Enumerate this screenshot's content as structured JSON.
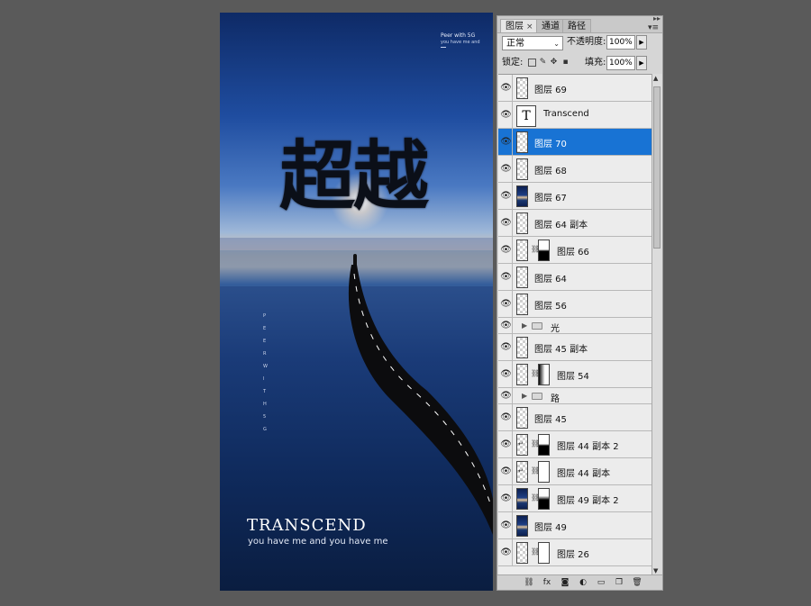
{
  "canvas": {
    "peer_line1": "Peer with 5G",
    "peer_line2": "you have me and",
    "hero_title": "超越",
    "vertical_text": "P\nE\nE\nR\nW\nI\nT\nH\n5\nG",
    "transcend": "TRANSCEND",
    "tagline": "you have me and you have me"
  },
  "panel": {
    "tabs": [
      {
        "label": "图层",
        "active": true
      },
      {
        "label": "通道",
        "active": false
      },
      {
        "label": "路径",
        "active": false
      }
    ],
    "blend_mode": "正常",
    "opacity_label": "不透明度:",
    "opacity_value": "100%",
    "lock_label": "锁定:",
    "fill_label": "填充:",
    "fill_value": "100%",
    "layers": [
      {
        "name": "图层 69",
        "kind": "pixel",
        "selected": false
      },
      {
        "name": "Transcend",
        "kind": "text",
        "selected": false
      },
      {
        "name": "图层 70",
        "kind": "pixel",
        "selected": true
      },
      {
        "name": "图层 68",
        "kind": "pixel",
        "selected": false
      },
      {
        "name": "图层 67",
        "kind": "photo",
        "selected": false
      },
      {
        "name": "图层 64 副本",
        "kind": "pixel",
        "selected": false
      },
      {
        "name": "图层 66",
        "kind": "masked",
        "mask": "dark",
        "selected": false
      },
      {
        "name": "图层 64",
        "kind": "pixel",
        "selected": false
      },
      {
        "name": "图层 56",
        "kind": "pixel",
        "selected": false
      },
      {
        "name": "光",
        "kind": "group",
        "selected": false
      },
      {
        "name": "图层 45 副本",
        "kind": "pixel",
        "selected": false
      },
      {
        "name": "图层 54",
        "kind": "masked",
        "mask": "grad",
        "selected": false
      },
      {
        "name": "路",
        "kind": "group",
        "selected": false
      },
      {
        "name": "图层 45",
        "kind": "pixel",
        "selected": false
      },
      {
        "name": "图层 44 副本 2",
        "kind": "masked",
        "mask": "dark",
        "clip": true,
        "selected": false
      },
      {
        "name": "图层 44 副本",
        "kind": "masked",
        "mask": "white",
        "clip": true,
        "selected": false
      },
      {
        "name": "图层 49 副本 2",
        "kind": "masked-photo",
        "mask": "black",
        "selected": false
      },
      {
        "name": "图层 49",
        "kind": "photo",
        "selected": false
      },
      {
        "name": "图层 26",
        "kind": "masked",
        "mask": "white",
        "selected": false
      }
    ],
    "footer_icons": [
      "link-icon",
      "fx-icon",
      "mask-icon",
      "adjustment-icon",
      "group-icon",
      "new-layer-icon",
      "trash-icon"
    ],
    "footer_glyphs": [
      "⛓",
      "fx",
      "◙",
      "◐",
      "▭",
      "❐",
      "🗑"
    ]
  }
}
